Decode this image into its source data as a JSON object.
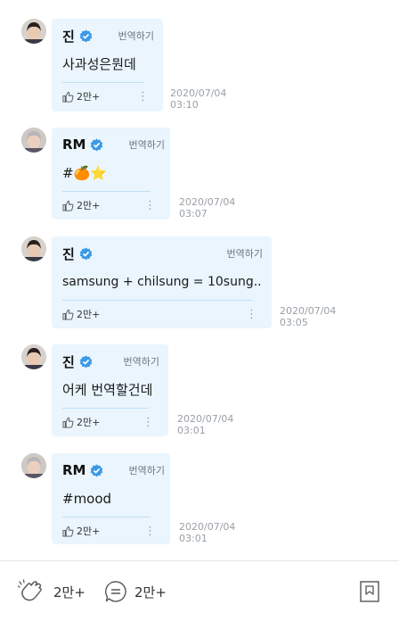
{
  "comments": [
    {
      "author": "진",
      "avatar": "jin-avatar",
      "translate_label": "번역하기",
      "text": "사과성은뭔데",
      "likes": "2만+",
      "date": "2020/07/04",
      "time": "03:10"
    },
    {
      "author": "RM",
      "avatar": "rm-avatar",
      "translate_label": "번역하기",
      "text": "#🍊⭐",
      "likes": "2만+",
      "date": "2020/07/04",
      "time": "03:07"
    },
    {
      "author": "진",
      "avatar": "jin-avatar",
      "translate_label": "번역하기",
      "text": "samsung + chilsung = 10sung..",
      "likes": "2만+",
      "date": "2020/07/04",
      "time": "03:05"
    },
    {
      "author": "진",
      "avatar": "jin-avatar",
      "translate_label": "번역하기",
      "text": "어케 번역할건데",
      "likes": "2만+",
      "date": "2020/07/04",
      "time": "03:01"
    },
    {
      "author": "RM",
      "avatar": "rm-avatar",
      "translate_label": "번역하기",
      "text": "#mood",
      "likes": "2만+",
      "date": "2020/07/04",
      "time": "03:01"
    }
  ],
  "bottom_bar": {
    "reactions_count": "2만+",
    "comments_count": "2만+",
    "icons": {
      "reaction": "applause-icon",
      "comment": "comment-bubble-icon",
      "bookmark": "bookmark-icon"
    }
  },
  "colors": {
    "bubble": "#eaf5fd",
    "verified": "#3b9ae8",
    "divider": "#bfe0f3",
    "timestamp": "#9aa0a6"
  }
}
